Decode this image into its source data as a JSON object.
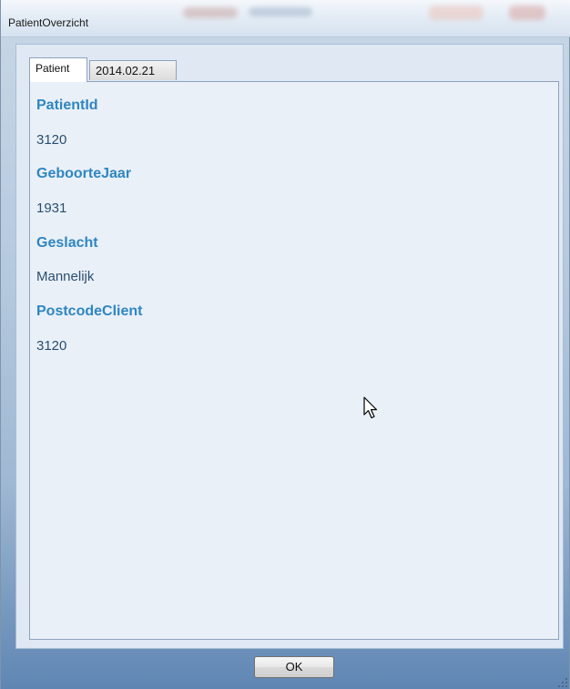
{
  "window": {
    "title": "PatientOverzicht"
  },
  "tabs": [
    {
      "label": "Patient",
      "selected": true
    },
    {
      "label": "2014.02.21",
      "selected": false
    }
  ],
  "patient": {
    "fields": [
      {
        "label": "PatientId",
        "value": "3120"
      },
      {
        "label": "GeboorteJaar",
        "value": "1931"
      },
      {
        "label": "Geslacht",
        "value": "Mannelijk"
      },
      {
        "label": "PostcodeClient",
        "value": "3120"
      }
    ]
  },
  "footer": {
    "ok_label": "OK"
  },
  "icons": {
    "cursor": "mouse-pointer-icon",
    "grip": "resize-grip-icon"
  },
  "colors": {
    "label": "#2e86c1",
    "value": "#2a4f70",
    "panel": "#eaf0f8"
  }
}
